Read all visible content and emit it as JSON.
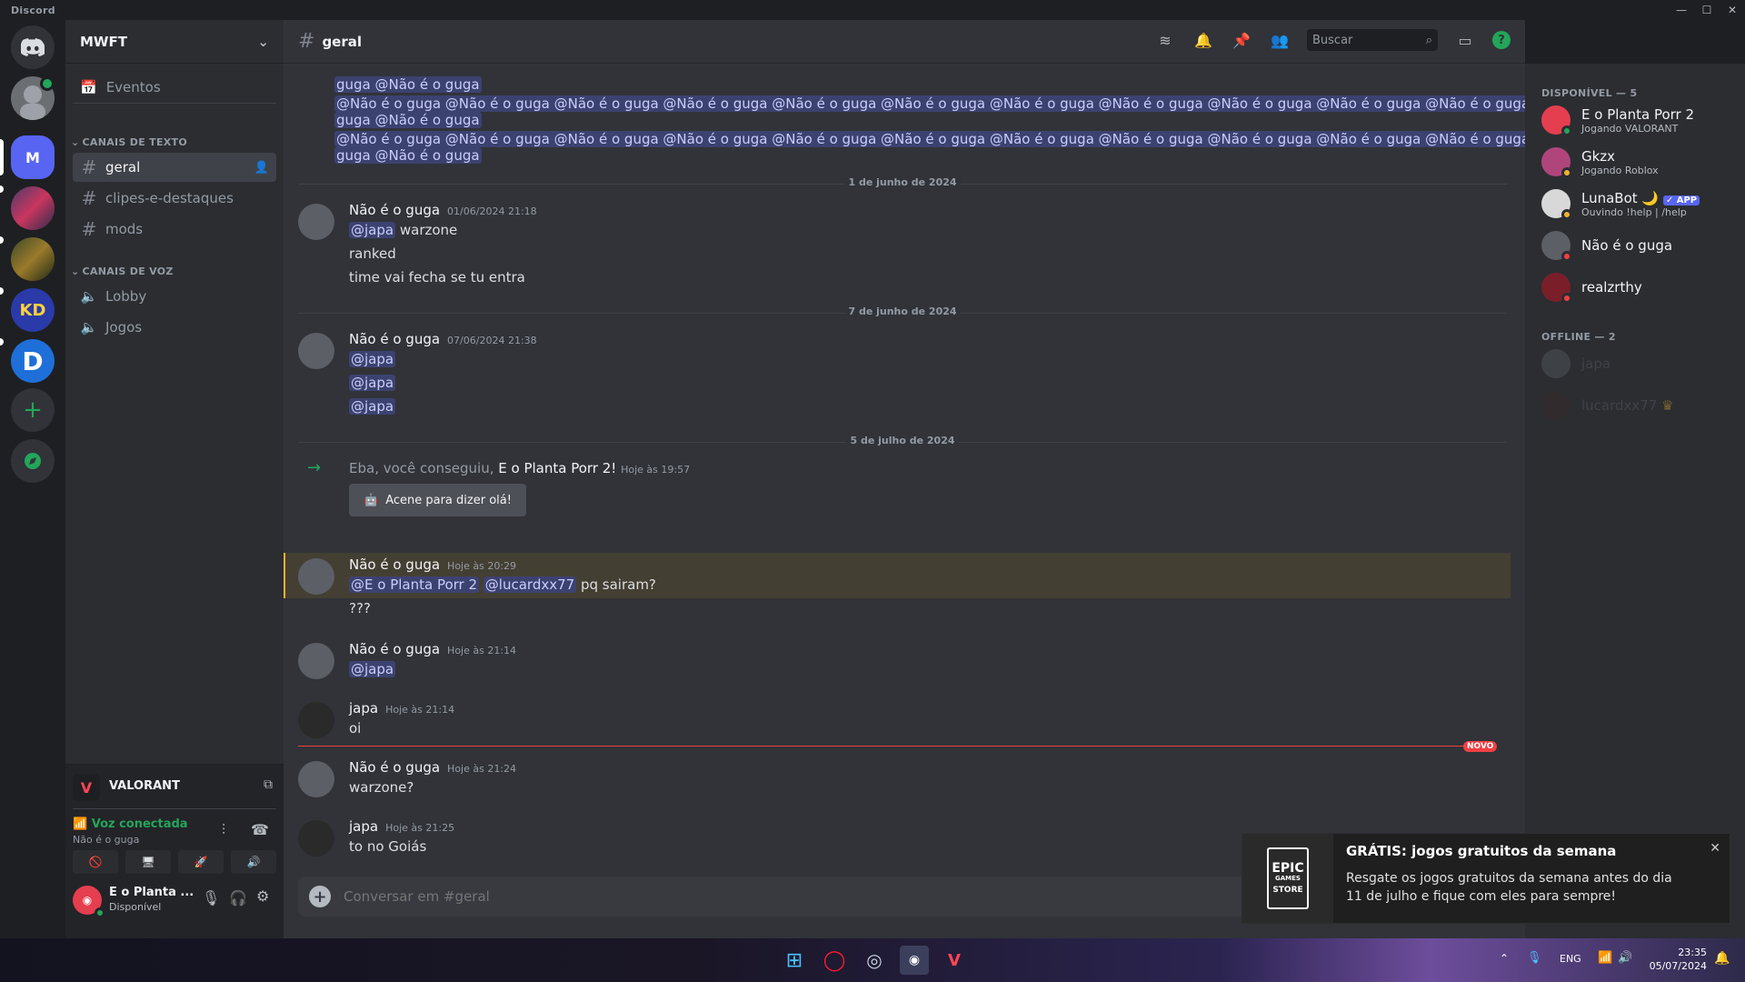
{
  "window": {
    "title": "Discord"
  },
  "server": {
    "name": "MWFT",
    "events_label": "Eventos"
  },
  "categories": {
    "text": "CANAIS DE TEXTO",
    "voice": "CANAIS DE VOZ"
  },
  "text_channels": [
    "geral",
    "clipes-e-destaques",
    "mods"
  ],
  "voice_channels": [
    "Lobby",
    "Jogos"
  ],
  "header": {
    "channel": "geral",
    "search_placeholder": "Buscar"
  },
  "guild_initial": "M",
  "spam_lines": [
    "guga @Não é o guga",
    "@Não é o guga @Não é o guga @Não é o guga @Não é o guga @Não é o guga @Não é o guga @Não é o guga @Não é o guga @Não é o guga @Não é o guga @Não é o guga @Não é o",
    "guga @Não é o guga",
    "@Não é o guga @Não é o guga @Não é o guga @Não é o guga @Não é o guga @Não é o guga @Não é o guga @Não é o guga @Não é o guga @Não é o guga @Não é o guga @Não é o",
    "guga @Não é o guga"
  ],
  "dividers": [
    "1 de junho de 2024",
    "7 de junho de 2024",
    "5 de julho de 2024"
  ],
  "messages": [
    {
      "author": "Não é o guga",
      "time": "01/06/2024 21:18",
      "lines": [
        "@japa|warzone",
        "ranked",
        "time vai fecha se tu entra"
      ]
    },
    {
      "author": "Não é o guga",
      "time": "07/06/2024 21:38",
      "lines": [
        "@japa",
        "@japa",
        "@japa"
      ]
    },
    {
      "author": "Não é o guga",
      "time": "Hoje às 20:29",
      "mentions": [
        "@E o Planta Porr 2",
        "@lucardxx77"
      ],
      "after": "pq sairam?",
      "line2": "???"
    },
    {
      "author": "Não é o guga",
      "time": "Hoje às 21:14",
      "lines": [
        "@japa"
      ]
    },
    {
      "author": "japa",
      "time": "Hoje às 21:14",
      "lines": [
        "oi"
      ]
    },
    {
      "author": "Não é o guga",
      "time": "Hoje às 21:24",
      "lines": [
        "warzone?"
      ]
    },
    {
      "author": "japa",
      "time": "Hoje às 21:25",
      "lines": [
        "to no Goiás"
      ]
    }
  ],
  "join": {
    "prefix": "Eba, você conseguiu,",
    "user": "E o Planta Porr 2",
    "suffix": "!",
    "time": "Hoje às 19:57",
    "wave_button": "Acene para dizer olá!"
  },
  "new_badge": "NOVO",
  "composer": {
    "placeholder": "Conversar em #geral"
  },
  "activity": {
    "game": "VALORANT",
    "voice_status": "Voz conectada",
    "voice_user": "Não é o guga"
  },
  "user": {
    "name": "E o Planta ...",
    "status": "Disponível"
  },
  "members": {
    "online_header": "DISPONÍVEL — 5",
    "offline_header": "OFFLINE — 2",
    "online": [
      {
        "name": "E o Planta Porr 2",
        "activity": "Jogando VALORANT",
        "status_color": "#23a55a"
      },
      {
        "name": "Gkzx",
        "activity": "Jogando Roblox",
        "status_color": "#f0b232"
      },
      {
        "name": "LunaBot 🌙",
        "activity": "Ouvindo !help | /help",
        "badge": "✓ APP",
        "status_color": "#f0b232"
      },
      {
        "name": "Não é o guga",
        "activity": "",
        "status_color": "#f23f43"
      },
      {
        "name": "realzrthy",
        "activity": "",
        "status_color": "#f23f43"
      }
    ],
    "offline": [
      {
        "name": "japa"
      },
      {
        "name": "lucardxx77",
        "crown": "♛"
      }
    ]
  },
  "toast": {
    "title": "GRÁTIS: jogos gratuitos da semana",
    "body": "Resgate os jogos gratuitos da semana antes do dia 11 de julho e fique com eles para sempre!",
    "logo_top": "EPIC",
    "logo_mid": "GAMES",
    "logo_bottom": "STORE"
  },
  "taskbar": {
    "lang": "ENG",
    "time": "23:35",
    "date": "05/07/2024"
  }
}
